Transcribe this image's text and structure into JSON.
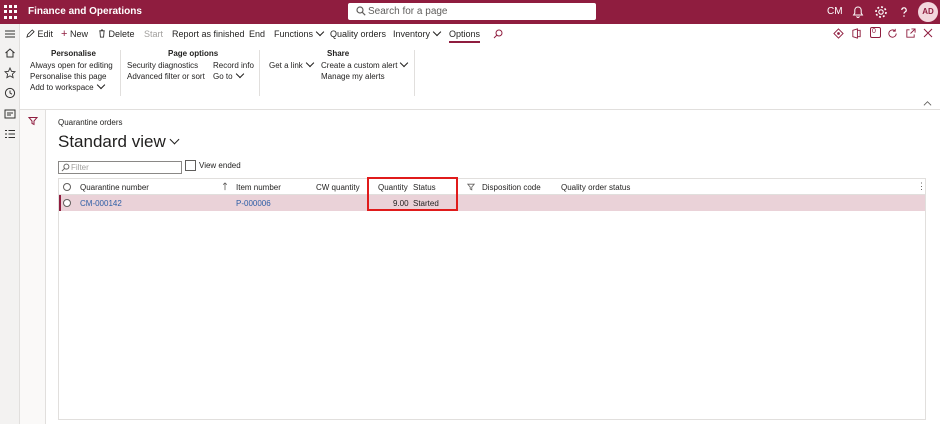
{
  "app": {
    "title": "Finance and Operations",
    "company": "CM",
    "user_initials": "AD"
  },
  "search": {
    "placeholder": "Search for a page"
  },
  "actionbar": {
    "edit": "Edit",
    "new": "New",
    "delete": "Delete",
    "start": "Start",
    "report_finished": "Report as finished",
    "end": "End",
    "functions": "Functions",
    "quality_orders": "Quality orders",
    "inventory": "Inventory",
    "options": "Options"
  },
  "ribbon": {
    "personalise": {
      "title": "Personalise",
      "items": [
        "Always open for editing",
        "Personalise this page",
        "Add to workspace"
      ]
    },
    "page_options": {
      "title": "Page options",
      "col1": [
        "Security diagnostics",
        "Advanced filter or sort"
      ],
      "col2": [
        "Record info",
        "Go to"
      ]
    },
    "link": {
      "items": [
        "Get a link"
      ]
    },
    "share": {
      "title": "Share",
      "items": [
        "Create a custom alert",
        "Manage my alerts"
      ]
    }
  },
  "page": {
    "breadcrumb": "Quarantine orders",
    "view_title": "Standard view",
    "filter_placeholder": "Filter",
    "view_ended": "View ended"
  },
  "grid": {
    "columns": [
      "Quarantine number",
      "Item number",
      "CW quantity",
      "Quantity",
      "Status",
      "Disposition code",
      "Quality order status"
    ],
    "rows": [
      {
        "quarantine_number": "CM-000142",
        "item_number": "P-000006",
        "cw_quantity": "",
        "quantity": "9.00",
        "status": "Started",
        "disposition_code": "",
        "quality_order_status": ""
      }
    ]
  },
  "colors": {
    "brand": "#8f1d3f",
    "highlight": "#e01b1b",
    "link": "#2d5ea6",
    "selected_row": "#ead2d8"
  },
  "notification_count": "0"
}
